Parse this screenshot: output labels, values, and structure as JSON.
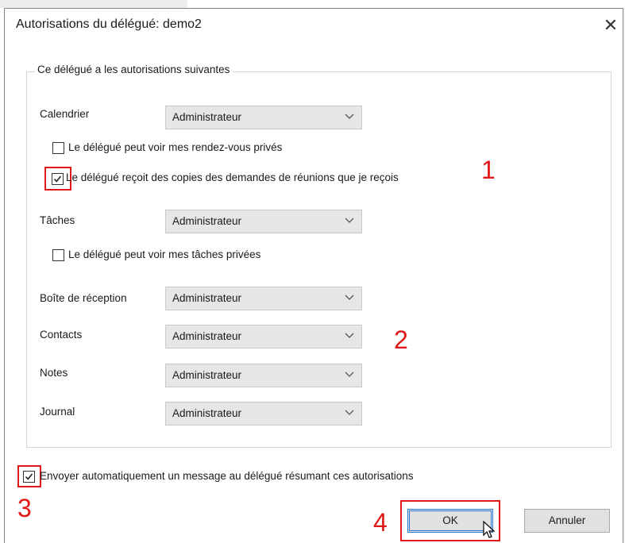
{
  "dialog": {
    "title": "Autorisations du délégué: demo2",
    "close_glyph": "✕"
  },
  "group_label": "Ce délégué a les autorisations suivantes",
  "permissions": {
    "calendar": {
      "label": "Calendrier",
      "value": "Administrateur"
    },
    "tasks": {
      "label": "Tâches",
      "value": "Administrateur"
    },
    "inbox": {
      "label": "Boîte de réception",
      "value": "Administrateur"
    },
    "contacts": {
      "label": "Contacts",
      "value": "Administrateur"
    },
    "notes": {
      "label": "Notes",
      "value": "Administrateur"
    },
    "journal": {
      "label": "Journal",
      "value": "Administrateur"
    }
  },
  "checkboxes": {
    "private_appointments": {
      "label": "Le délégué peut voir mes rendez-vous privés",
      "checked": false
    },
    "meeting_copies": {
      "label": "Le délégué reçoit des copies des demandes de réunions que je reçois",
      "checked": true
    },
    "private_tasks": {
      "label": "Le délégué peut voir mes tâches privées",
      "checked": false
    },
    "auto_message": {
      "label": "Envoyer automatiquement un message au délégué résumant ces autorisations",
      "checked": true
    }
  },
  "buttons": {
    "ok": "OK",
    "cancel": "Annuler"
  },
  "annotations": {
    "one": "1",
    "two": "2",
    "three": "3",
    "four": "4"
  },
  "colors": {
    "annotation_red": "#e01818",
    "ok_focus_blue": "#2b7bd6"
  },
  "icons": {
    "close": "close-icon",
    "dropdown": "chevron-down-icon",
    "check": "checkmark-icon",
    "cursor": "mouse-pointer-icon"
  }
}
